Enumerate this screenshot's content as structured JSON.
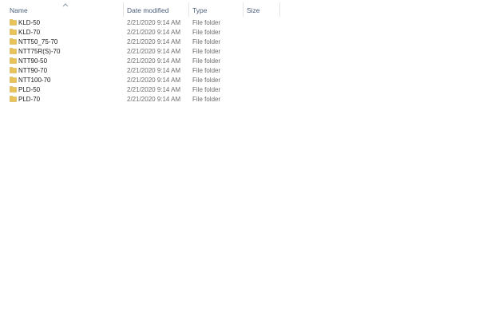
{
  "columns": {
    "name": "Name",
    "date_modified": "Date modified",
    "type": "Type",
    "size": "Size"
  },
  "sort_indicator_icon": "chevron-up-icon",
  "folder_icon_color": "#e8c35a",
  "files": [
    {
      "name": "KLD-50",
      "date": "2/21/2020 9:14 AM",
      "type": "File folder",
      "size": ""
    },
    {
      "name": "KLD-70",
      "date": "2/21/2020 9:14 AM",
      "type": "File folder",
      "size": ""
    },
    {
      "name": "NTT50_75-70",
      "date": "2/21/2020 9:14 AM",
      "type": "File folder",
      "size": ""
    },
    {
      "name": "NTT75R(S)-70",
      "date": "2/21/2020 9:14 AM",
      "type": "File folder",
      "size": ""
    },
    {
      "name": "NTT90-50",
      "date": "2/21/2020 9:14 AM",
      "type": "File folder",
      "size": ""
    },
    {
      "name": "NTT90-70",
      "date": "2/21/2020 9:14 AM",
      "type": "File folder",
      "size": ""
    },
    {
      "name": "NTT100-70",
      "date": "2/21/2020 9:14 AM",
      "type": "File folder",
      "size": ""
    },
    {
      "name": "PLD-50",
      "date": "2/21/2020 9:14 AM",
      "type": "File folder",
      "size": ""
    },
    {
      "name": "PLD-70",
      "date": "2/21/2020 9:14 AM",
      "type": "File folder",
      "size": ""
    }
  ]
}
